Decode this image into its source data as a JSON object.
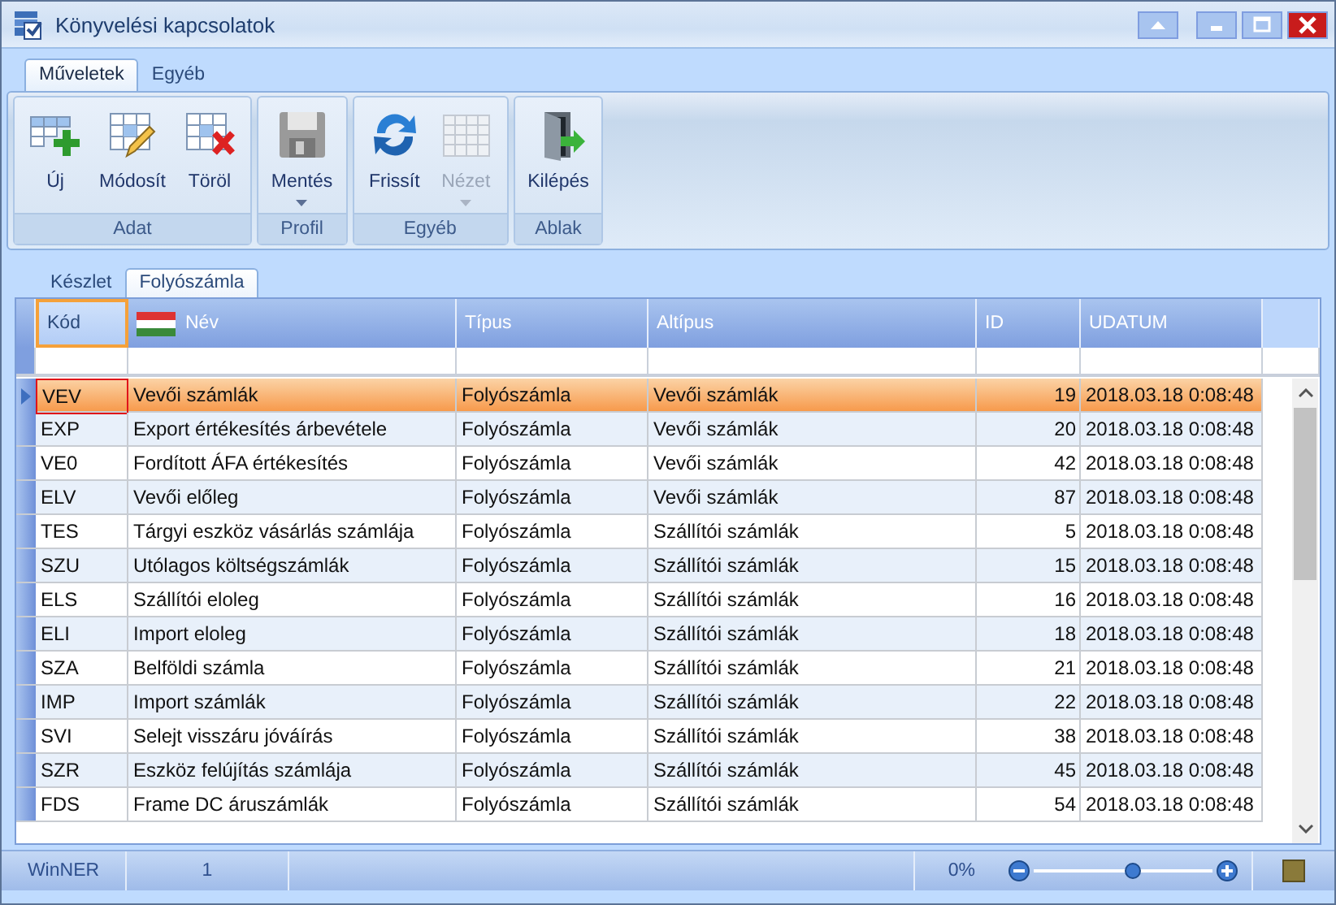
{
  "window": {
    "title": "Könyvelési kapcsolatok"
  },
  "ribbon": {
    "tabs": [
      {
        "label": "Műveletek",
        "selected": true
      },
      {
        "label": "Egyéb",
        "selected": false
      }
    ],
    "groups": [
      {
        "label": "Adat",
        "buttons": [
          {
            "label": "Új",
            "kind": "add",
            "disabled": false,
            "dropdown": false
          },
          {
            "label": "Módosít",
            "kind": "edit",
            "disabled": false,
            "dropdown": false
          },
          {
            "label": "Töröl",
            "kind": "delete",
            "disabled": false,
            "dropdown": false
          }
        ]
      },
      {
        "label": "Profil",
        "buttons": [
          {
            "label": "Mentés",
            "kind": "save",
            "disabled": false,
            "dropdown": true
          }
        ]
      },
      {
        "label": "Egyéb",
        "buttons": [
          {
            "label": "Frissít",
            "kind": "refresh",
            "disabled": false,
            "dropdown": false
          },
          {
            "label": "Nézet",
            "kind": "view",
            "disabled": true,
            "dropdown": true
          }
        ]
      },
      {
        "label": "Ablak",
        "buttons": [
          {
            "label": "Kilépés",
            "kind": "exit",
            "disabled": false,
            "dropdown": false
          }
        ]
      }
    ]
  },
  "doc_tabs": [
    {
      "label": "Készlet",
      "selected": false
    },
    {
      "label": "Folyószámla",
      "selected": true
    }
  ],
  "table": {
    "columns": [
      {
        "label": "Kód",
        "flag": false,
        "numeric": false,
        "focused": true
      },
      {
        "label": "Név",
        "flag": true,
        "numeric": false,
        "focused": false
      },
      {
        "label": "Típus",
        "flag": false,
        "numeric": false,
        "focused": false
      },
      {
        "label": "Altípus",
        "flag": false,
        "numeric": false,
        "focused": false
      },
      {
        "label": "ID",
        "flag": false,
        "numeric": true,
        "focused": false
      },
      {
        "label": "UDATUM",
        "flag": false,
        "numeric": false,
        "focused": false
      }
    ],
    "rows": [
      {
        "selected": true,
        "cells": [
          "VEV",
          "Vevői számlák",
          "Folyószámla",
          "Vevői számlák",
          "19",
          "2018.03.18 0:08:48"
        ]
      },
      {
        "selected": false,
        "cells": [
          "EXP",
          "Export értékesítés árbevétele",
          "Folyószámla",
          "Vevői számlák",
          "20",
          "2018.03.18 0:08:48"
        ]
      },
      {
        "selected": false,
        "cells": [
          "VE0",
          "Fordított ÁFA értékesítés",
          "Folyószámla",
          "Vevői számlák",
          "42",
          "2018.03.18 0:08:48"
        ]
      },
      {
        "selected": false,
        "cells": [
          "ELV",
          "Vevői előleg",
          "Folyószámla",
          "Vevői számlák",
          "87",
          "2018.03.18 0:08:48"
        ]
      },
      {
        "selected": false,
        "cells": [
          "TES",
          "Tárgyi eszköz vásárlás számlája",
          "Folyószámla",
          "Szállítói számlák",
          "5",
          "2018.03.18 0:08:48"
        ]
      },
      {
        "selected": false,
        "cells": [
          "SZU",
          "Utólagos költségszámlák",
          "Folyószámla",
          "Szállítói számlák",
          "15",
          "2018.03.18 0:08:48"
        ]
      },
      {
        "selected": false,
        "cells": [
          "ELS",
          "Szállítói eloleg",
          "Folyószámla",
          "Szállítói számlák",
          "16",
          "2018.03.18 0:08:48"
        ]
      },
      {
        "selected": false,
        "cells": [
          "ELI",
          "Import eloleg",
          "Folyószámla",
          "Szállítói számlák",
          "18",
          "2018.03.18 0:08:48"
        ]
      },
      {
        "selected": false,
        "cells": [
          "SZA",
          "Belföldi számla",
          "Folyószámla",
          "Szállítói számlák",
          "21",
          "2018.03.18 0:08:48"
        ]
      },
      {
        "selected": false,
        "cells": [
          "IMP",
          "Import számlák",
          "Folyószámla",
          "Szállítói számlák",
          "22",
          "2018.03.18 0:08:48"
        ]
      },
      {
        "selected": false,
        "cells": [
          "SVI",
          "Selejt visszáru jóváírás",
          "Folyószámla",
          "Szállítói számlák",
          "38",
          "2018.03.18 0:08:48"
        ]
      },
      {
        "selected": false,
        "cells": [
          "SZR",
          "Eszköz felújítás számlája",
          "Folyószámla",
          "Szállítói számlák",
          "45",
          "2018.03.18 0:08:48"
        ]
      },
      {
        "selected": false,
        "cells": [
          "FDS",
          "Frame DC áruszámlák",
          "Folyószámla",
          "Szállítói számlák",
          "54",
          "2018.03.18 0:08:48"
        ]
      }
    ]
  },
  "status_bar": {
    "items": [
      "WinNER",
      "1"
    ],
    "zoom": {
      "reading": "0%",
      "level": 0.55
    }
  }
}
